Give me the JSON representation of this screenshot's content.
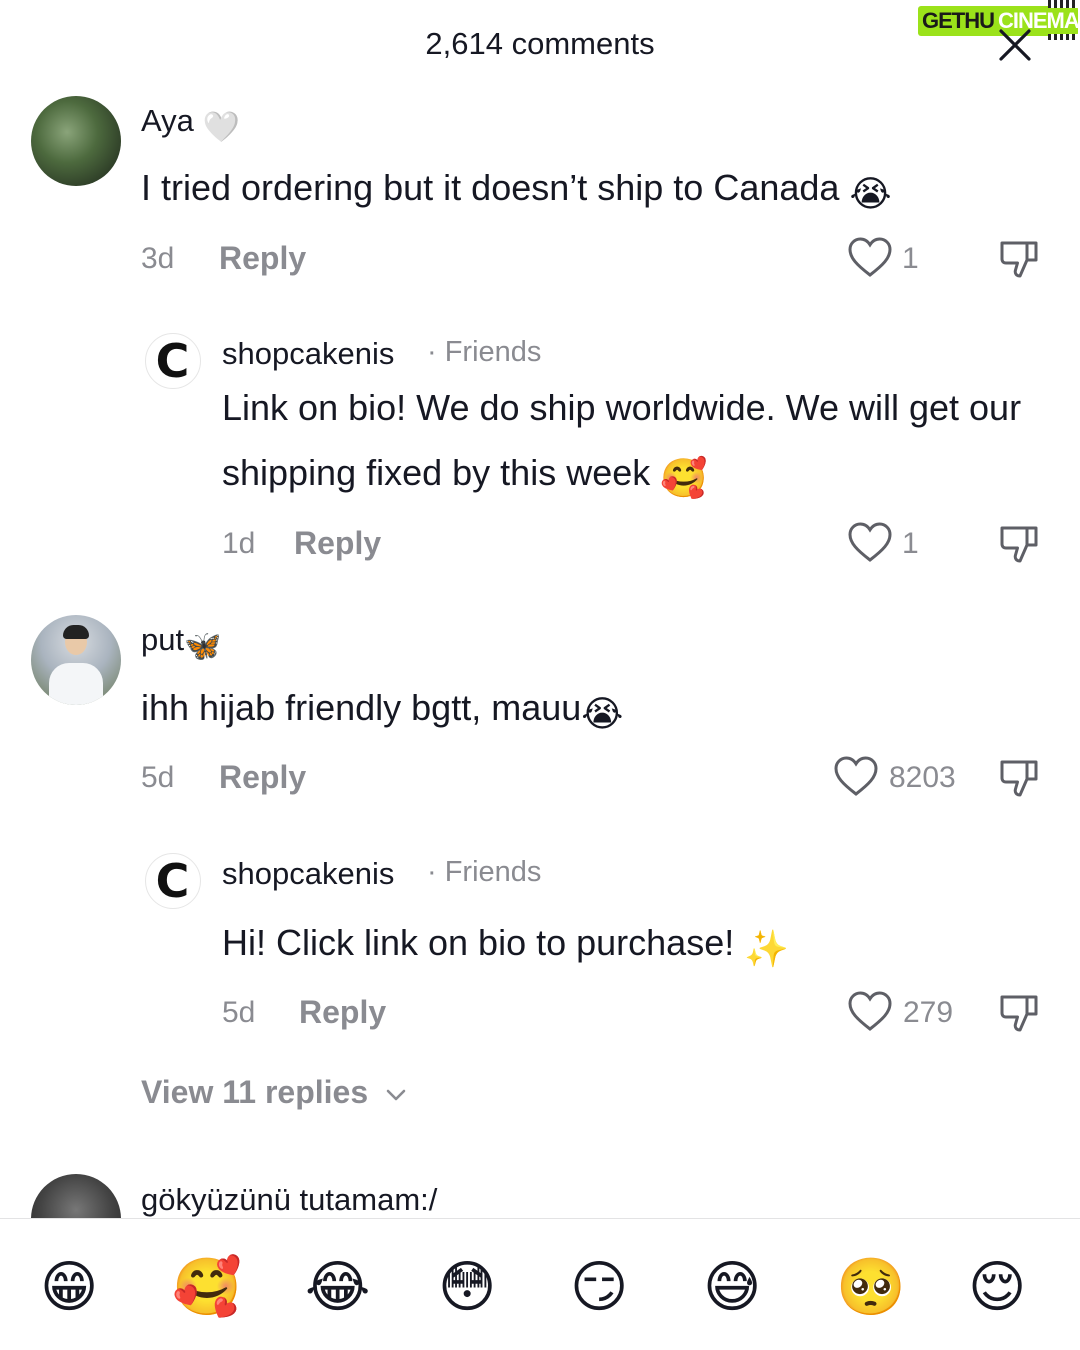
{
  "header": {
    "title": "2,614 comments",
    "watermark_part1": "GETHU",
    "watermark_part2": "CINEMA"
  },
  "comments": [
    {
      "username": "Aya",
      "username_emoji": "🤍",
      "text": "I tried ordering but it doesn’t ship to Canada",
      "text_emoji": "😭",
      "time": "3d",
      "reply_label": "Reply",
      "likes": "1",
      "reply": {
        "username": "shopcakenis",
        "badge": "· Friends",
        "avatar_letter": "C",
        "text": "Link on bio! We do ship worldwide. We will get our shipping fixed by this week",
        "text_emoji": "🥰",
        "time": "1d",
        "reply_label": "Reply",
        "likes": "1"
      }
    },
    {
      "username": "put",
      "username_emoji": "🦋",
      "text": "ihh hijab friendly bgtt, mauu",
      "text_emoji": "😭",
      "time": "5d",
      "reply_label": "Reply",
      "likes": "8203",
      "reply": {
        "username": "shopcakenis",
        "badge": "· Friends",
        "avatar_letter": "C",
        "text": "Hi! Click link on bio to purchase!",
        "text_emoji": "✨",
        "time": "5d",
        "reply_label": "Reply",
        "likes": "279"
      },
      "view_replies": "View 11 replies"
    },
    {
      "username": "gökyüzünü tutamam:/"
    }
  ],
  "emoji_bar": [
    "😁",
    "🥰",
    "😂",
    "😳",
    "😏",
    "😅",
    "🥺",
    "😌"
  ],
  "colors": {
    "text_primary": "#161823",
    "text_secondary": "#8a8b91",
    "watermark_green": "#9be21a"
  },
  "icons": [
    "close-icon",
    "heart-outline-icon",
    "dislike-icon",
    "chevron-down-icon"
  ]
}
